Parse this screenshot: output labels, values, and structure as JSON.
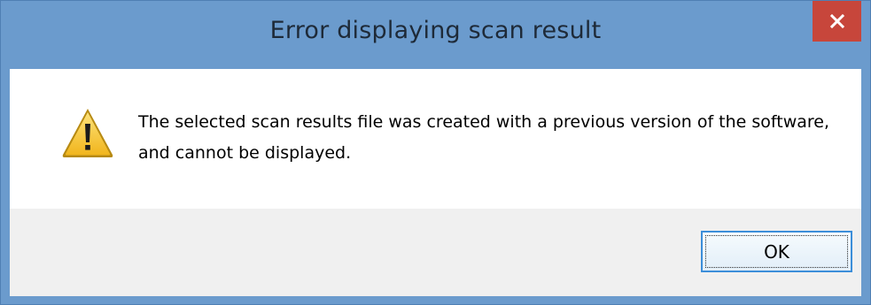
{
  "window": {
    "title": "Error displaying scan result"
  },
  "titlebar": {
    "close_icon": "close-icon"
  },
  "dialog": {
    "icon": "warning-icon",
    "message": "The selected scan results file was created with a previous version of the software, and cannot be displayed."
  },
  "buttons": {
    "ok_label": "OK"
  },
  "colors": {
    "title_bar": "#6b9bcd",
    "close_button": "#c7463b",
    "footer": "#f0f0f0",
    "button_border": "#3c8ed9",
    "warning_fill": "#f7c325"
  }
}
